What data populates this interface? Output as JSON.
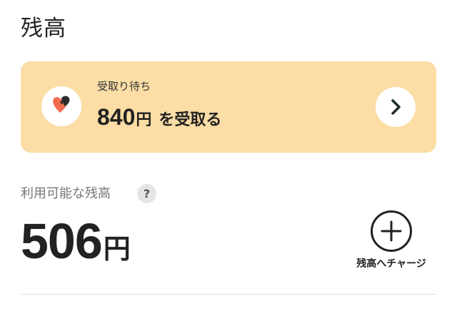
{
  "page": {
    "title": "残高"
  },
  "pending": {
    "label": "受取り待ち",
    "amount": "840",
    "currency": "円",
    "action": "を受取る",
    "icon": "heart-logo-icon",
    "colors": {
      "card_bg": "#fbdda5",
      "heart_primary": "#f26b4f",
      "heart_secondary": "#2b2b2b"
    }
  },
  "balance": {
    "label": "利用可能な残高",
    "help_icon_text": "?",
    "amount": "506",
    "currency": "円"
  },
  "charge": {
    "label": "残高へチャージ",
    "icon": "plus-circle-icon"
  }
}
